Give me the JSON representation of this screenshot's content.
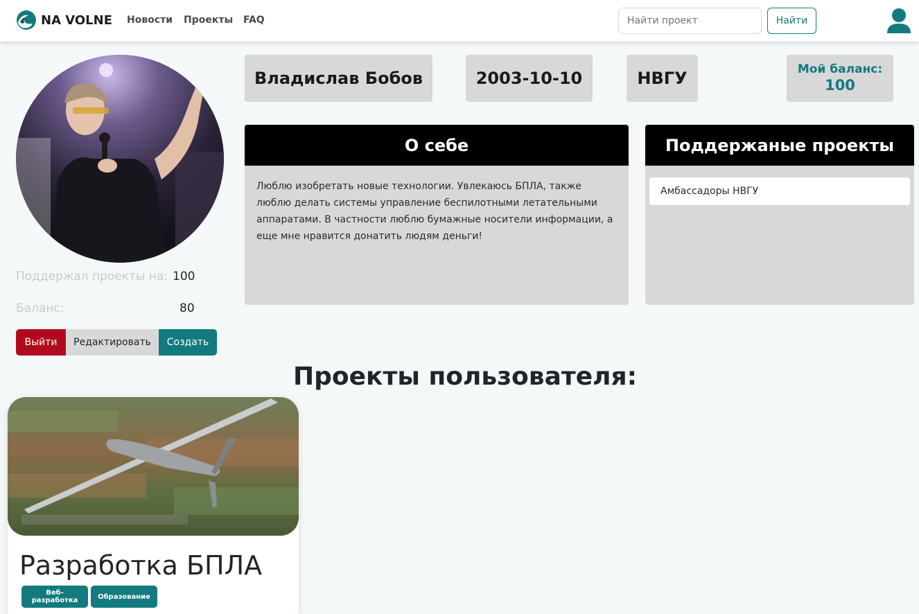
{
  "navbar": {
    "brand": "NA VOLNE",
    "links": [
      "Новости",
      "Проекты",
      "FAQ"
    ],
    "search_placeholder": "Найти проект",
    "search_button": "Найти"
  },
  "profile": {
    "name": "Владислав Бобов",
    "birth_date": "2003-10-10",
    "university": "НВГУ",
    "my_balance_label": "Мой баланс:",
    "my_balance_value": "100",
    "supported_label": "Поддержал проекты на:",
    "supported_value": "100",
    "balance_label": "Баланс:",
    "balance_value": "80"
  },
  "actions": {
    "logout": "Выйти",
    "edit": "Редактировать",
    "create": "Создать"
  },
  "about": {
    "title": "О себе",
    "text": "Люблю изобретать новые технологии. Увлекаюсь БПЛА, также люблю делать системы управление беспилотными летательными аппаратами. В частности люблю бумажные носители информации, а еще мне нравится донатить людям деньги!"
  },
  "supported_projects": {
    "title": "Поддержаные проекты",
    "items": [
      "Амбассадоры НВГУ"
    ]
  },
  "user_projects": {
    "title": "Проекты пользователя:",
    "cards": [
      {
        "title": "Разработка БПЛА",
        "tags": [
          "Веб-разработка",
          "Образование"
        ]
      }
    ]
  },
  "colors": {
    "accent": "#137a7f",
    "danger": "#b00b1d",
    "panel": "#d8d8d8"
  }
}
